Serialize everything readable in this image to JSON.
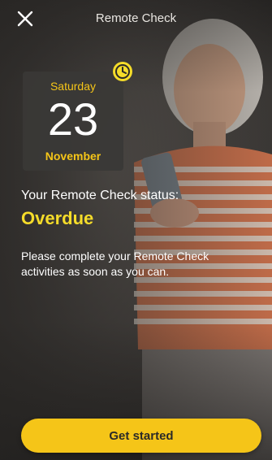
{
  "header": {
    "title": "Remote Check",
    "close_icon": "close-icon"
  },
  "calendar": {
    "day": "Saturday",
    "date": "23",
    "month": "November",
    "badge_icon": "clock-icon"
  },
  "status": {
    "label": "Your Remote Check status:",
    "value": "Overdue"
  },
  "message": "Please complete your Remote Check activities as soon as you can.",
  "cta": {
    "label": "Get started"
  },
  "colors": {
    "accent": "#f5c518",
    "status": "#f5dc2a",
    "panel": "#3a3836"
  }
}
